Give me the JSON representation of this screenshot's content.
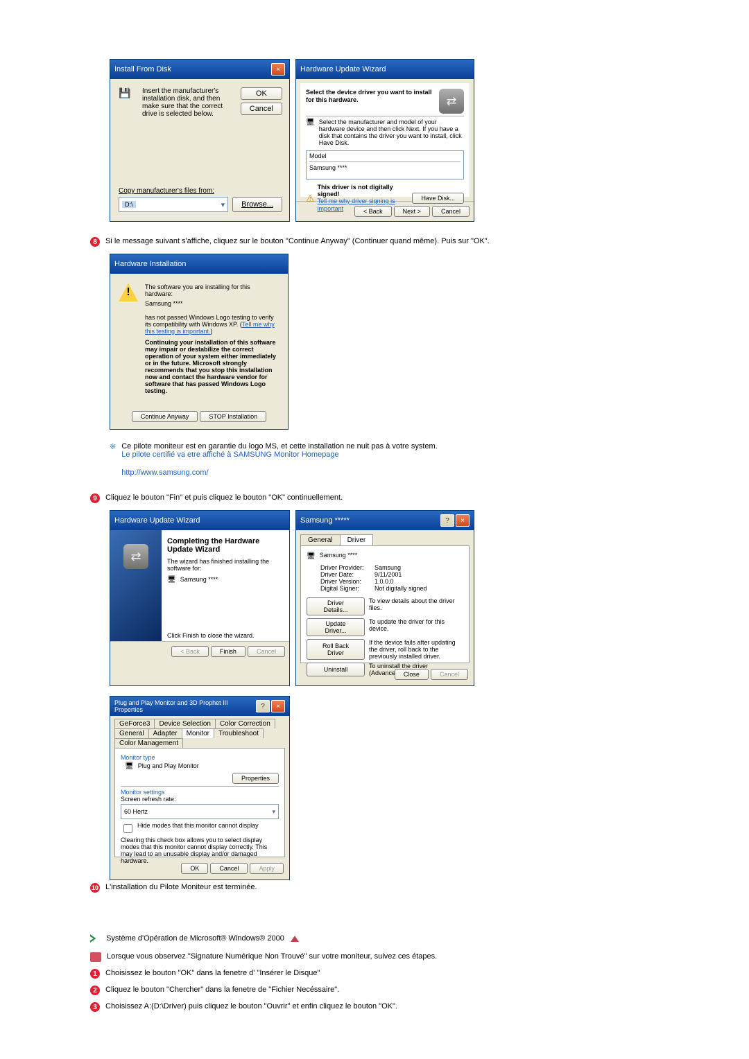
{
  "ifd": {
    "title": "Install From Disk",
    "instruction": "Insert the manufacturer's installation disk, and then make sure that the correct drive is selected below.",
    "ok": "OK",
    "cancel": "Cancel",
    "copy_label": "Copy manufacturer's files from:",
    "copy_value": "D:\\",
    "browse": "Browse..."
  },
  "huw_select": {
    "title": "Hardware Update Wizard",
    "heading": "Select the device driver you want to install for this hardware.",
    "instruction": "Select the manufacturer and model of your hardware device and then click Next. If you have a disk that contains the driver you want to install, click Have Disk.",
    "model_label": "Model",
    "model_value": "Samsung ****",
    "unsigned_text": "This driver is not digitally signed!",
    "tell_me": "Tell me why driver signing is important",
    "have_disk": "Have Disk...",
    "back": "< Back",
    "next": "Next >",
    "cancel": "Cancel"
  },
  "step8": "Si le message suivant s'affiche, cliquez sur le bouton \"Continue Anyway\" (Continuer quand même). Puis sur \"OK\".",
  "hwinst": {
    "title": "Hardware Installation",
    "line1": "The software you are installing for this hardware:",
    "line2": "Samsung ****",
    "line3": "has not passed Windows Logo testing to verify its compatibility with Windows XP. (",
    "tell_me": "Tell me why this testing is important.",
    "line3_end": ")",
    "warn": "Continuing your installation of this software may impair or destabilize the correct operation of your system either immediately or in the future. Microsoft strongly recommends that you stop this installation now and contact the hardware vendor for software that has passed Windows Logo testing.",
    "continue": "Continue Anyway",
    "stop": "STOP Installation"
  },
  "note": {
    "line1": "Ce pilote moniteur est en garantie du logo MS, et cette installation ne nuit pas à votre system.",
    "line2": "Le pilote certifié va etre affiché à SAMSUNG Monitor Homepage",
    "url": "http://www.samsung.com/"
  },
  "step9": "Cliquez le bouton \"Fin\" et puis cliquez le bouton \"OK\" continuellement.",
  "huw_done": {
    "title": "Hardware Update Wizard",
    "heading": "Completing the Hardware Update Wizard",
    "line1": "The wizard has finished installing the software for:",
    "line2": "Samsung ****",
    "line3": "Click Finish to close the wizard.",
    "back": "< Back",
    "finish": "Finish",
    "cancel": "Cancel"
  },
  "props": {
    "title": "Samsung *****",
    "tab_general": "General",
    "tab_driver": "Driver",
    "device": "Samsung ****",
    "dp_label": "Driver Provider:",
    "dp_val": "Samsung",
    "dd_label": "Driver Date:",
    "dd_val": "9/11/2001",
    "dv_label": "Driver Version:",
    "dv_val": "1.0.0.0",
    "ds_label": "Digital Signer:",
    "ds_val": "Not digitally signed",
    "btn_details": "Driver Details...",
    "desc_details": "To view details about the driver files.",
    "btn_update": "Update Driver...",
    "desc_update": "To update the driver for this device.",
    "btn_roll": "Roll Back Driver",
    "desc_roll": "If the device fails after updating the driver, roll back to the previously installed driver.",
    "btn_uninst": "Uninstall",
    "desc_uninst": "To uninstall the driver (Advanced).",
    "close": "Close",
    "cancel": "Cancel"
  },
  "disp": {
    "title": "Plug and Play Monitor and 3D Prophet III Properties",
    "tabs_top": [
      "GeForce3",
      "Device Selection",
      "Color Correction"
    ],
    "tabs_bot": [
      "General",
      "Adapter",
      "Monitor",
      "Troubleshoot",
      "Color Management"
    ],
    "mt_label": "Monitor type",
    "mt_value": "Plug and Play Monitor",
    "properties": "Properties",
    "ms_label": "Monitor settings",
    "refresh_label": "Screen refresh rate:",
    "refresh_value": "60 Hertz",
    "hide_label": "Hide modes that this monitor cannot display",
    "hide_desc": "Clearing this check box allows you to select display modes that this monitor cannot display correctly. This may lead to an unusable display and/or damaged hardware.",
    "ok": "OK",
    "cancel": "Cancel",
    "apply": "Apply"
  },
  "step10": "L'installation du Pilote Moniteur est terminée.",
  "os2000": "Système d'Opération de Microsoft® Windows® 2000",
  "step_sig": "Lorsque vous observez \"Signature Numérique Non Trouvé\" sur votre moniteur, suivez ces étapes.",
  "b1": "Choisissez le bouton \"OK\" dans la fenetre d' \"Insérer le Disque\"",
  "b2": "Cliquez le bouton \"Chercher\" dans la fenetre de \"Fichier Necéssaire\".",
  "b3": "Choisissez A:(D:\\Driver) puis cliquez le bouton \"Ouvrir\" et enfin cliquez le bouton \"OK\"."
}
